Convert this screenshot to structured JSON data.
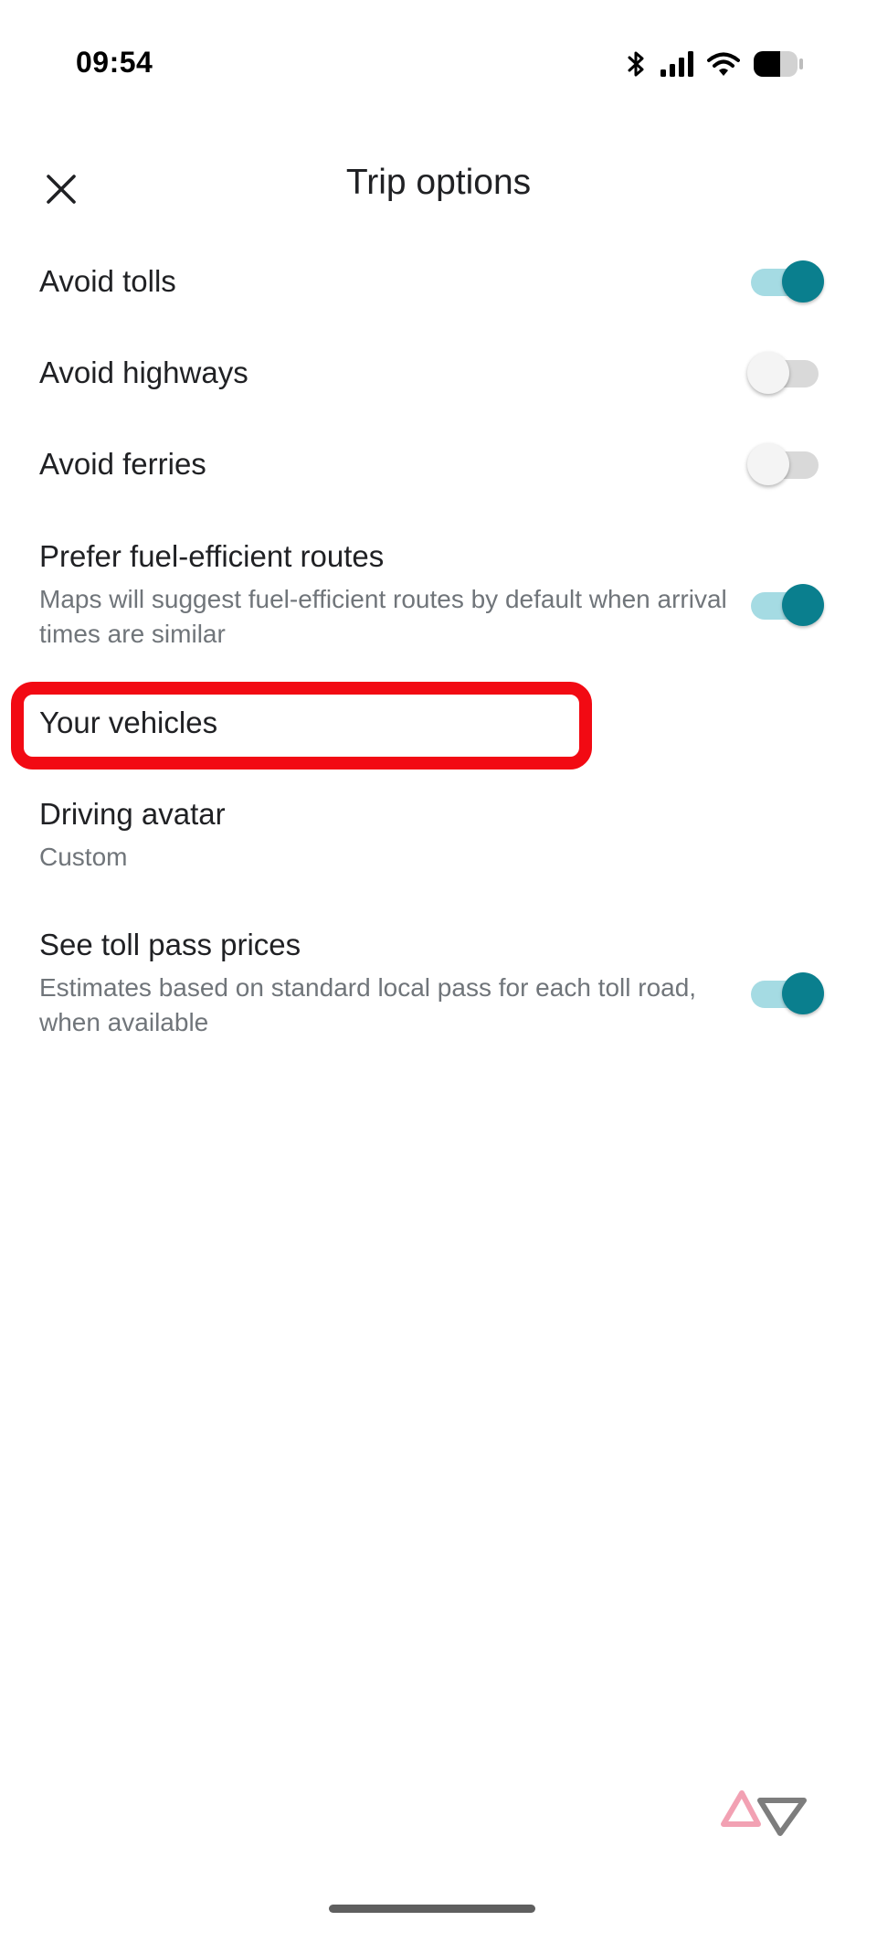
{
  "status_bar": {
    "time": "09:54",
    "icons": [
      "bluetooth-icon",
      "cellular-signal-icon",
      "wifi-icon",
      "battery-icon"
    ]
  },
  "header": {
    "close_icon": "close-icon",
    "title": "Trip options"
  },
  "options": {
    "avoid_tolls": {
      "label": "Avoid tolls",
      "enabled": true
    },
    "avoid_highways": {
      "label": "Avoid highways",
      "enabled": false
    },
    "avoid_ferries": {
      "label": "Avoid ferries",
      "enabled": false
    },
    "fuel_efficient": {
      "label": "Prefer fuel-efficient routes",
      "subtitle": "Maps will suggest fuel-efficient routes by default when arrival times are similar",
      "enabled": true
    },
    "your_vehicles": {
      "label": "Your vehicles",
      "highlighted": true
    },
    "driving_avatar": {
      "label": "Driving avatar",
      "subtitle": "Custom"
    },
    "toll_pass_prices": {
      "label": "See toll pass prices",
      "subtitle": "Estimates based on standard local pass for each toll road, when available",
      "enabled": true
    }
  },
  "colors": {
    "toggle_on_knob": "#0a7f8e",
    "toggle_on_track": "#a5dbe3",
    "toggle_off_knob": "#f4f4f4",
    "toggle_off_track": "#d9d9d9",
    "highlight": "#f20a13",
    "text_primary": "#202124",
    "text_secondary": "#70757a",
    "watermark_pink": "#f2a1b3",
    "watermark_gray": "#7d7d7d"
  }
}
